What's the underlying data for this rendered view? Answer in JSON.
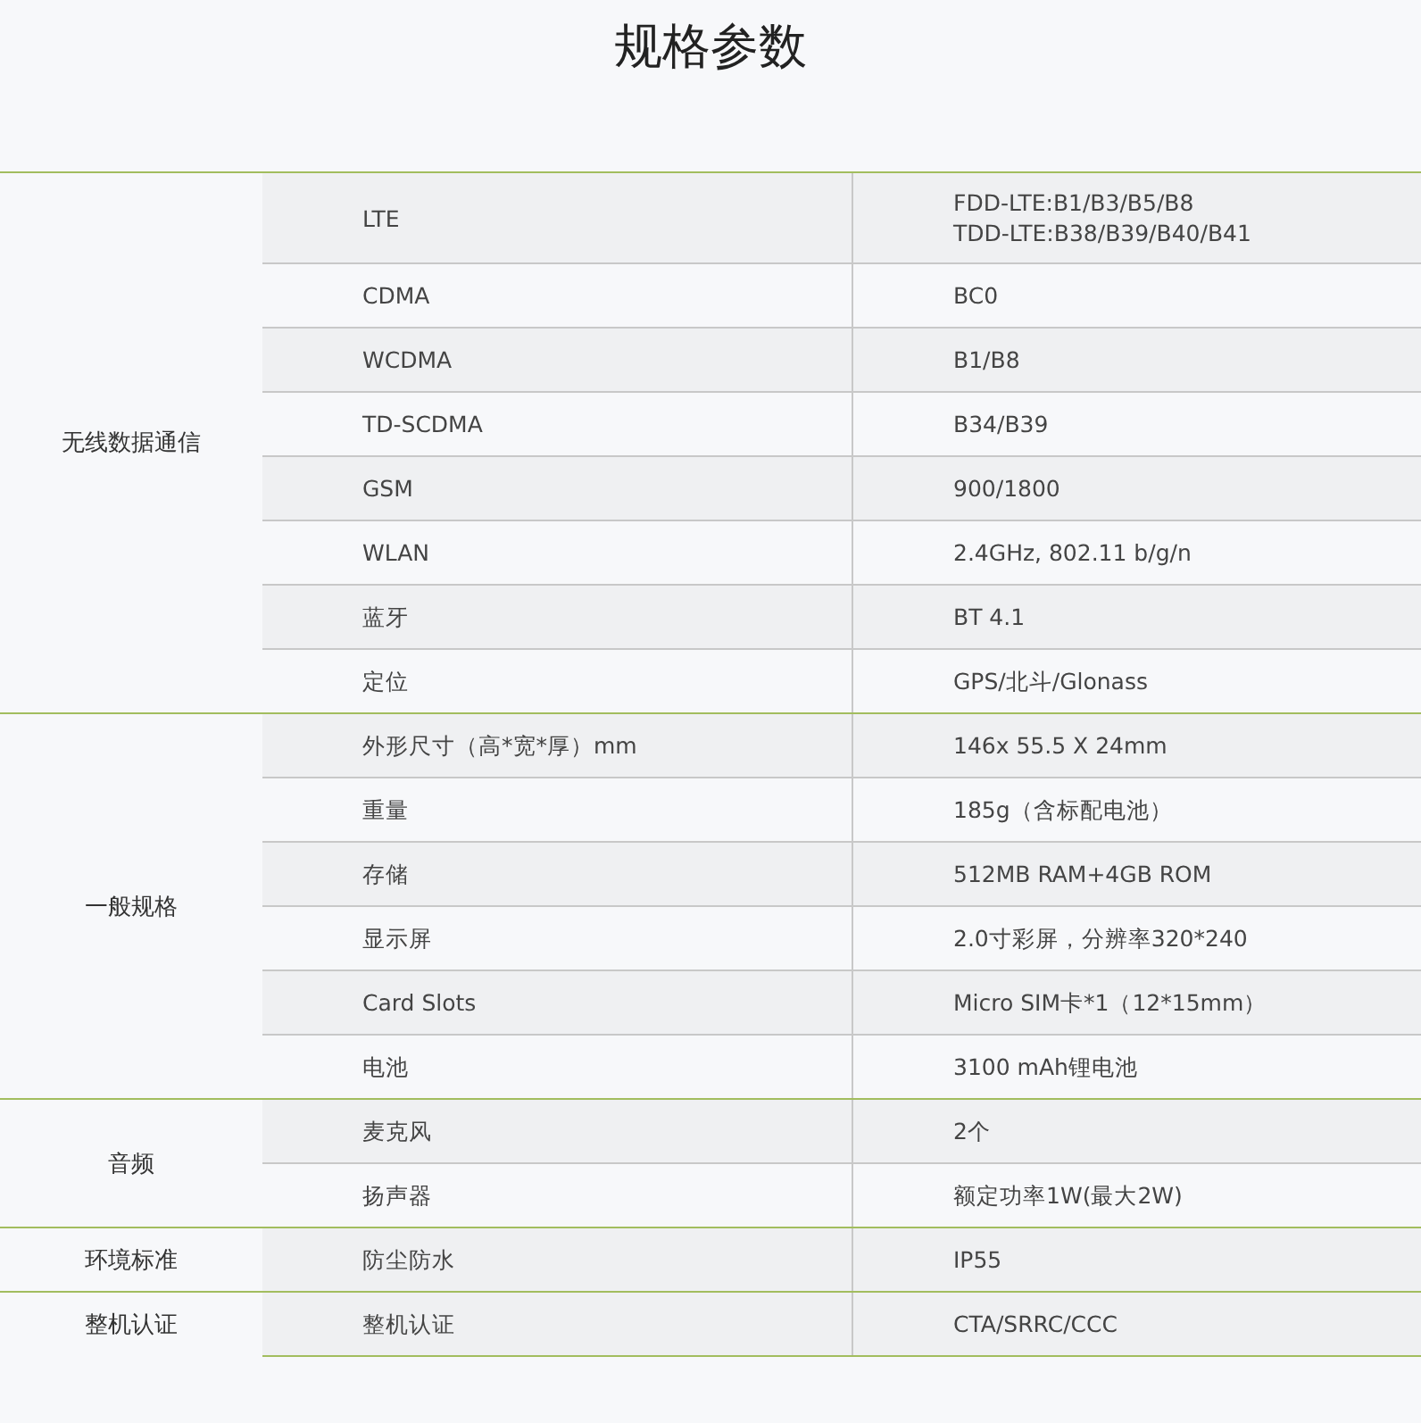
{
  "title": "规格参数",
  "groups": [
    {
      "name": "无线数据通信",
      "rows": [
        {
          "label": "LTE",
          "value": [
            "FDD-LTE:B1/B3/B5/B8",
            "TDD-LTE:B38/B39/B40/B41"
          ]
        },
        {
          "label": "CDMA",
          "value": [
            "BC0"
          ]
        },
        {
          "label": "WCDMA",
          "value": [
            "B1/B8"
          ]
        },
        {
          "label": "TD-SCDMA",
          "value": [
            "B34/B39"
          ]
        },
        {
          "label": "GSM",
          "value": [
            "900/1800"
          ]
        },
        {
          "label": "WLAN",
          "value": [
            "2.4GHz, 802.11 b/g/n"
          ]
        },
        {
          "label": "蓝牙",
          "value": [
            "BT 4.1"
          ]
        },
        {
          "label": "定位",
          "value": [
            "GPS/北斗/Glonass"
          ]
        }
      ]
    },
    {
      "name": "一般规格",
      "rows": [
        {
          "label": "外形尺寸（高*宽*厚）mm",
          "value": [
            "146x 55.5 X 24mm"
          ]
        },
        {
          "label": "重量",
          "value": [
            "185g（含标配电池）"
          ]
        },
        {
          "label": "存储",
          "value": [
            "512MB RAM+4GB ROM"
          ]
        },
        {
          "label": "显示屏",
          "value": [
            "2.0寸彩屏，分辨率320*240"
          ]
        },
        {
          "label": "Card Slots",
          "value": [
            "Micro SIM卡*1（12*15mm）"
          ]
        },
        {
          "label": "电池",
          "value": [
            "3100 mAh锂电池"
          ]
        }
      ]
    },
    {
      "name": "音频",
      "rows": [
        {
          "label": "麦克风",
          "value": [
            "2个"
          ]
        },
        {
          "label": "扬声器",
          "value": [
            "额定功率1W(最大2W)"
          ]
        }
      ]
    },
    {
      "name": "环境标准",
      "rows": [
        {
          "label": "防尘防水",
          "value": [
            "IP55"
          ]
        }
      ]
    },
    {
      "name": "整机认证",
      "rows": [
        {
          "label": "整机认证",
          "value": [
            "CTA/SRRC/CCC"
          ]
        }
      ]
    }
  ]
}
